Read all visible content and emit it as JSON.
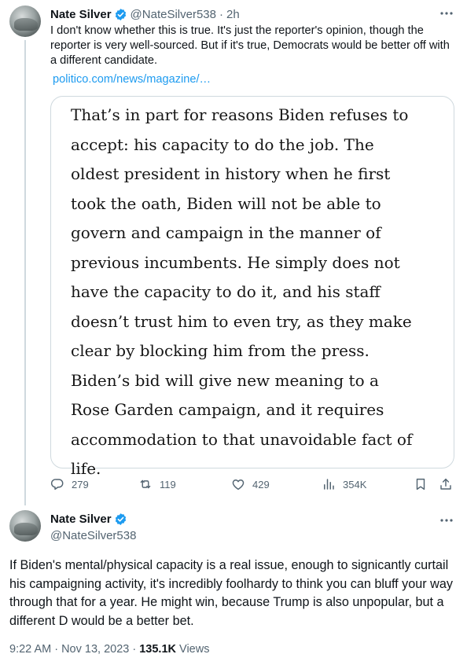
{
  "tweet1": {
    "author_name": "Nate Silver",
    "handle": "@NateSilver538",
    "separator": "·",
    "time": "2h",
    "text": "I don't know whether this is true. It's just the reporter's opinion, though the reporter is very well-sourced. But if it's true, Democrats would be better off with a different candidate.",
    "link": "politico.com/news/magazine/…",
    "quote_lines": [
      "That’s in part for reasons Biden refuses to",
      "accept: his capacity to do the job. The",
      "oldest president in history when he first",
      "took the oath, Biden will not be able to",
      "govern and campaign in the manner of",
      "previous incumbents. He simply does not",
      "have the capacity to do it, and his staff",
      "doesn’t trust him to even try, as they make",
      "clear by blocking him from the press.",
      "Biden’s bid will give new meaning to a",
      "Rose Garden campaign, and it requires",
      "accommodation to that unavoidable fact of",
      "life."
    ],
    "actions": {
      "replies": "279",
      "retweets": "119",
      "likes": "429",
      "views": "354K"
    }
  },
  "tweet2": {
    "author_name": "Nate Silver",
    "handle": "@NateSilver538",
    "text": "If Biden's mental/physical capacity is a real issue, enough to signicantly curtail his campaigning activity, it's incredibly foolhardy to think you can bluff your way through that for a year. He might win, because Trump is also unpopular, but a different D would be a better bet.",
    "timestamp": "9:22 AM · Nov 13, 2023 · ",
    "views_count": "135.1K",
    "views_label": " Views"
  },
  "colors": {
    "verified": "#1d9bf0",
    "link": "#1d9bf0",
    "secondary_text": "#536471",
    "border": "#cfd9de"
  },
  "icons": [
    "verified-badge-icon",
    "more-icon",
    "reply-icon",
    "retweet-icon",
    "like-icon",
    "views-icon",
    "bookmark-icon",
    "share-icon"
  ]
}
